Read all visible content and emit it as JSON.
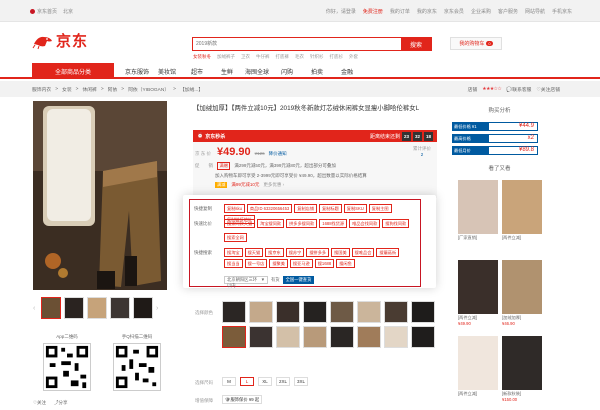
{
  "topbar": {
    "left": [
      "京东首页",
      "北京"
    ],
    "right": [
      "你好，请登录",
      "免费注册",
      "我的订单",
      "我的京东",
      "京东会员",
      "企业采购",
      "客户服务",
      "网站导航",
      "手机京东"
    ]
  },
  "header": {
    "logo_text": "京东",
    "search_placeholder": "2019新款",
    "search_button": "搜索",
    "hotwords": [
      "女装秋冬",
      "加绒裤子",
      "卫衣",
      "牛仔裤",
      "打底裤",
      "毛衣",
      "针织衫",
      "打底衫",
      "外套"
    ],
    "cart_label": "我的购物车",
    "cart_count": "0"
  },
  "nav": {
    "all_categories": "全部商品分类",
    "items": [
      "京东服饰",
      "美妆馆",
      "超市",
      "生鲜",
      "海囤全球",
      "闪购",
      "拍卖",
      "金融"
    ]
  },
  "breadcrumb": {
    "items": [
      "服饰内衣",
      ">",
      "女装",
      ">",
      "休闲裤",
      ">",
      "阿依",
      ">",
      "阿依（YIBOGAN）",
      ">",
      "【加绒...】"
    ],
    "shop_rating_label": "店铺",
    "stars": "★★★☆☆",
    "contact": "联系客服",
    "follow": "关注店铺"
  },
  "product": {
    "title": "【加绒加厚】【两件立减10元】2019秋冬新款灯芯绒休闲裤女显瘦小脚哈伦裤女L",
    "promo_icon": "alarm-clock-icon",
    "promo_name": "京东秒杀",
    "countdown_label": "距离结束还剩",
    "countdown": [
      "23",
      "32",
      "18"
    ],
    "price_label": "京 东 价",
    "price": "¥49.90",
    "old_price": "¥126",
    "price_note": "降价通知",
    "comment_label": "累计评价",
    "comment_count": "2",
    "coupon_label": "促　　销",
    "coupon_tag": "满赠",
    "coupon_text": "满299元减50元，满399元减80元，超出部分可叠加",
    "coupon_detail": "加入购物车即可享受 2-3999元即可享受价 ¥49.90，超出数量以实际价格结算",
    "coupon_tag2": "满减",
    "coupon_red": "满99元减10元",
    "coupon_more": "更多优惠 ›"
  },
  "extension": {
    "rows": [
      {
        "label": "快捷复制",
        "buttons": [
          "复制sku",
          "商品ID 63320656453",
          "复制店铺",
          "复制标题",
          "复制SKU",
          "复制主图",
          "复制链接地址"
        ]
      },
      {
        "label": "快速比价",
        "buttons": [
          "搜索同款天猫",
          "淘宝搜同款",
          "拼多多搜同款",
          "1688找货源",
          "唯品会找同款",
          "搜狗找同款"
        ]
      },
      {
        "label": "",
        "buttons": [
          "搜索全网"
        ]
      },
      {
        "label": "快捷搜索",
        "buttons": [
          "搜淘宝",
          "搜天猫",
          "搜京东",
          "搜苏宁",
          "搜拼多多",
          "搜国美",
          "搜唯品会",
          "搜蘑菇街",
          "搜当当",
          "搜一号店",
          "搜聚美",
          "搜亚马逊",
          "搜1688",
          "搜闲鱼",
          "搜网易考拉",
          "搜小红书",
          "搜什么值得买",
          "搜微博",
          "搜知乎"
        ]
      }
    ],
    "select_label": "北京朝阳区三环以内",
    "select_arrow": "▼",
    "valid": "有货",
    "go_button": "全国一键查货"
  },
  "variants": {
    "color_label": "选择颜色",
    "size_label": "选择尺码",
    "sizes": [
      "M",
      "L",
      "XL",
      "2XL",
      "3XL"
    ],
    "active_size": "L",
    "note": "请先选择颜色尺码",
    "quality_label": "增值保障",
    "quality_text": "服饰保价 ¥9 起"
  },
  "side": {
    "compare_title": "购买分析",
    "compare": [
      {
        "k": "最低价格 ¥1",
        "v": "¥44.9"
      },
      {
        "k": "最高价格",
        "v": "x2"
      },
      {
        "k": "最低月价",
        "v": "¥89.8"
      }
    ],
    "recs_title": "看了又看",
    "recs": [
      {
        "t": "[厂家直销]",
        "p": "¥59.00"
      },
      {
        "t": "[两件立减]",
        "p": "¥58.90"
      },
      {
        "t": "[两件立减]",
        "p": "¥49.90"
      },
      {
        "t": "[加绒加厚]",
        "p": "¥46.90"
      },
      {
        "t": "[两件立减]",
        "p": "¥49.90"
      },
      {
        "t": "[新款秋装]",
        "p": "¥150.00"
      }
    ]
  },
  "gallery": {
    "qr1_label": "App二维码",
    "qr2_label": "手Q扫描二维码",
    "follow": "关注",
    "share": "分享"
  }
}
